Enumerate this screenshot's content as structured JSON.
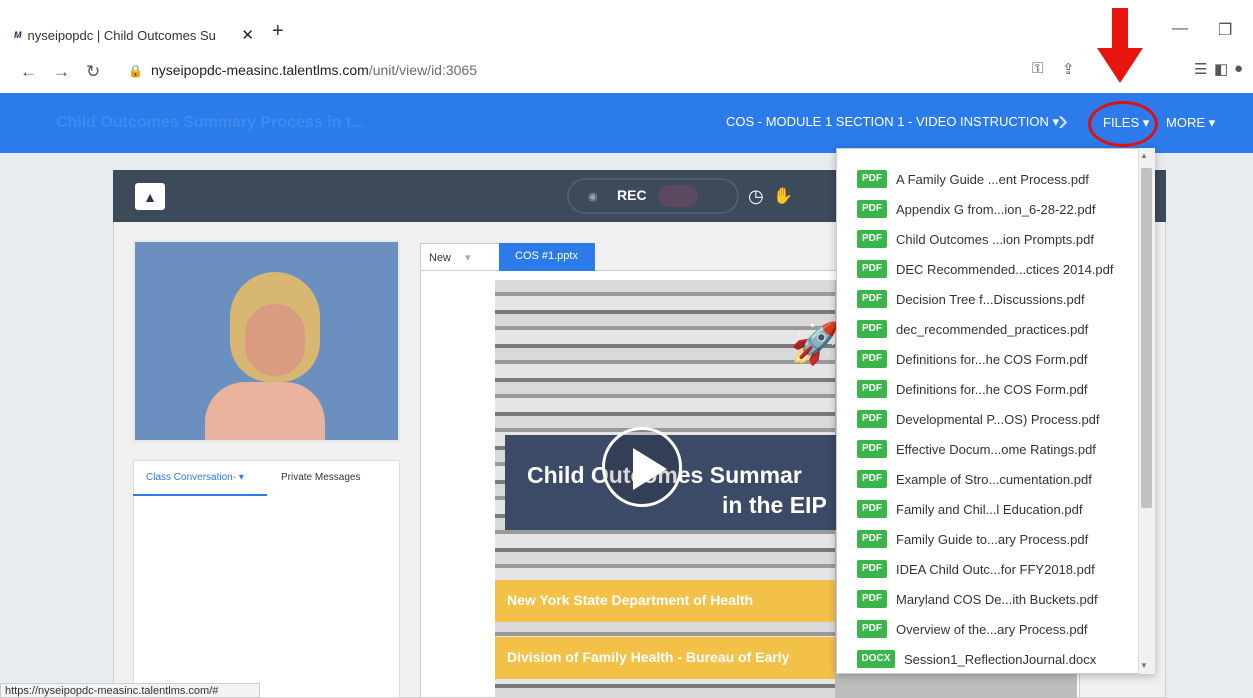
{
  "browser": {
    "tab_title": "nyseipopdc | Child Outcomes Su",
    "favicon_text": "M",
    "url_host": "nyseipopdc-measinc.talentlms.com",
    "url_path": "/unit/view/id:3065",
    "status_url": "https://nyseipopdc-measinc.talentlms.com/#"
  },
  "header": {
    "course_title": "Child Outcomes Summary Process in t...",
    "unit_select": "COS - MODULE 1 SECTION 1 - VIDEO INSTRUCTION",
    "files_label": "FILES",
    "more_label": "MORE"
  },
  "conference": {
    "rec_label": "REC"
  },
  "chat": {
    "tab_conversation": "Class Conversation-",
    "tab_private": "Private Messages"
  },
  "slides": {
    "tab_new": "New",
    "tab_file": "COS #1.pptx",
    "title_line1": "Child Outcomes Summar",
    "title_line2": "in the EIP",
    "banner1": "New York State Department of Health",
    "banner2": "Division of Family Health - Bureau of Early"
  },
  "files_menu": {
    "items": [
      {
        "type": "PDF",
        "name": "A Family Guide ...ent Process.pdf"
      },
      {
        "type": "PDF",
        "name": "Appendix G from...ion_6-28-22.pdf"
      },
      {
        "type": "PDF",
        "name": "Child Outcomes ...ion Prompts.pdf"
      },
      {
        "type": "PDF",
        "name": "DEC Recommended...ctices 2014.pdf"
      },
      {
        "type": "PDF",
        "name": "Decision Tree f...Discussions.pdf"
      },
      {
        "type": "PDF",
        "name": "dec_recommended_practices.pdf"
      },
      {
        "type": "PDF",
        "name": "Definitions for...he COS Form.pdf"
      },
      {
        "type": "PDF",
        "name": "Definitions for...he COS Form.pdf"
      },
      {
        "type": "PDF",
        "name": "Developmental P...OS) Process.pdf"
      },
      {
        "type": "PDF",
        "name": "Effective Docum...ome Ratings.pdf"
      },
      {
        "type": "PDF",
        "name": "Example of Stro...cumentation.pdf"
      },
      {
        "type": "PDF",
        "name": "Family and Chil...l Education.pdf"
      },
      {
        "type": "PDF",
        "name": "Family Guide to...ary Process.pdf"
      },
      {
        "type": "PDF",
        "name": "IDEA Child Outc...for FFY2018.pdf"
      },
      {
        "type": "PDF",
        "name": "Maryland COS De...ith Buckets.pdf"
      },
      {
        "type": "PDF",
        "name": "Overview of the...ary Process.pdf"
      },
      {
        "type": "DOCX",
        "name": "Session1_ReflectionJournal.docx"
      }
    ]
  },
  "colors": {
    "header_blue": "#2b7bea",
    "badge_green": "#3ab54a",
    "annotation_red": "#e8150e"
  }
}
